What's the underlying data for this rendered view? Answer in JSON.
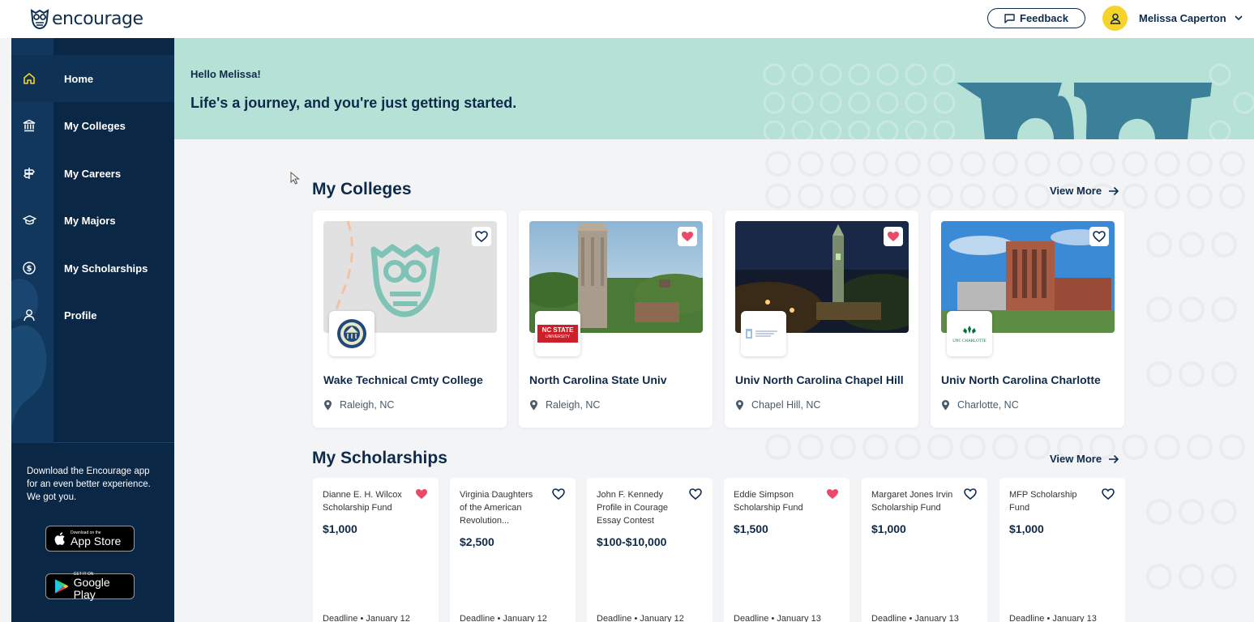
{
  "brand": {
    "name": "encourage",
    "icon": "owl-logo-icon"
  },
  "header": {
    "feedback_label": "Feedback",
    "user_name": "Melissa Caperton",
    "avatar_color": "#f6d32a"
  },
  "sidebar": {
    "items": [
      {
        "label": "Home",
        "icon": "home-icon",
        "active": true
      },
      {
        "label": "My Colleges",
        "icon": "institution-icon"
      },
      {
        "label": "My Careers",
        "icon": "signpost-icon"
      },
      {
        "label": "My Majors",
        "icon": "graduation-cap-icon"
      },
      {
        "label": "My Scholarships",
        "icon": "dollar-circle-icon"
      },
      {
        "label": "Profile",
        "icon": "person-icon"
      }
    ],
    "promo_line1": "Download the Encourage app",
    "promo_line2": "for an even better experience.",
    "promo_line3": "We got you.",
    "app_store": {
      "small": "Download on the",
      "big": "App Store"
    },
    "google_play": {
      "small": "GET IT ON",
      "big": "Google Play"
    }
  },
  "hero": {
    "greeting": "Hello Melissa!",
    "tagline": "Life's a journey, and you're just getting started.",
    "background": "#b6e1d7"
  },
  "colleges": {
    "title": "My Colleges",
    "view_more": "View More",
    "items": [
      {
        "name": "Wake Technical Cmty College",
        "location": "Raleigh, NC",
        "favorited": false
      },
      {
        "name": "North Carolina State Univ",
        "location": "Raleigh, NC",
        "favorited": true,
        "logo_text": "NC STATE",
        "logo_sub": "UNIVERSITY"
      },
      {
        "name": "Univ North Carolina Chapel Hill",
        "location": "Chapel Hill, NC",
        "favorited": true
      },
      {
        "name": "Univ North Carolina Charlotte",
        "location": "Charlotte, NC",
        "favorited": false,
        "logo_text": "UNC CHARLOTTE"
      }
    ]
  },
  "scholarships": {
    "title": "My Scholarships",
    "view_more": "View More",
    "items": [
      {
        "name_l1": "Dianne E. H. Wilcox",
        "name_l2": "Scholarship Fund",
        "name_l3": "",
        "amount": "$1,000",
        "favorited": true,
        "deadline": "Deadline • January 12"
      },
      {
        "name_l1": "Virginia Daughters",
        "name_l2": "of the American",
        "name_l3": "Revolution...",
        "amount": "$2,500",
        "favorited": false,
        "deadline": "Deadline • January 12"
      },
      {
        "name_l1": "John F. Kennedy",
        "name_l2": "Profile in Courage",
        "name_l3": "Essay Contest",
        "amount": "$100-$10,000",
        "favorited": false,
        "deadline": "Deadline • January 12"
      },
      {
        "name_l1": "Eddie Simpson",
        "name_l2": "Scholarship Fund",
        "name_l3": "",
        "amount": "$1,500",
        "favorited": true,
        "deadline": "Deadline • January 13"
      },
      {
        "name_l1": "Margaret Jones Irvin",
        "name_l2": "Scholarship Fund",
        "name_l3": "",
        "amount": "$1,000",
        "favorited": false,
        "deadline": "Deadline • January 13"
      },
      {
        "name_l1": "MFP Scholarship",
        "name_l2": "Fund",
        "name_l3": "",
        "amount": "$1,000",
        "favorited": false,
        "deadline": "Deadline • January 13"
      }
    ]
  },
  "colors": {
    "navy": "#0b2746",
    "accent_heart": "#ea4a67",
    "hero": "#b6e1d7"
  }
}
